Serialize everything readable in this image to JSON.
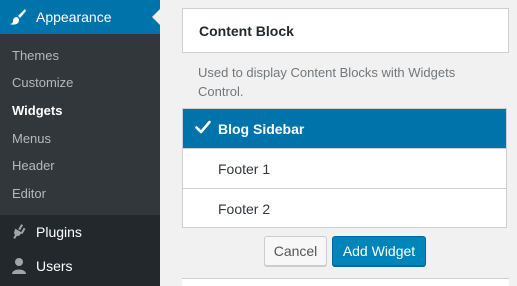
{
  "sidebar": {
    "active_menu": {
      "label": "Appearance",
      "icon": "paintbrush-icon"
    },
    "submenu": [
      {
        "label": "Themes",
        "current": false
      },
      {
        "label": "Customize",
        "current": false
      },
      {
        "label": "Widgets",
        "current": true
      },
      {
        "label": "Menus",
        "current": false
      },
      {
        "label": "Header",
        "current": false
      },
      {
        "label": "Editor",
        "current": false
      }
    ],
    "menu_items": [
      {
        "label": "Plugins",
        "icon": "plugin-icon"
      },
      {
        "label": "Users",
        "icon": "user-icon"
      }
    ]
  },
  "widget": {
    "title": "Content Block",
    "description": "Used to display Content Blocks with Widgets Control.",
    "areas": [
      {
        "label": "Blog Sidebar",
        "selected": true
      },
      {
        "label": "Footer 1",
        "selected": false
      },
      {
        "label": "Footer 2",
        "selected": false
      }
    ],
    "cancel_label": "Cancel",
    "add_label": "Add Widget"
  },
  "colors": {
    "sidebar_bg": "#23282d",
    "submenu_bg": "#32373c",
    "accent": "#0073aa",
    "primary_button": "#0085ba"
  }
}
